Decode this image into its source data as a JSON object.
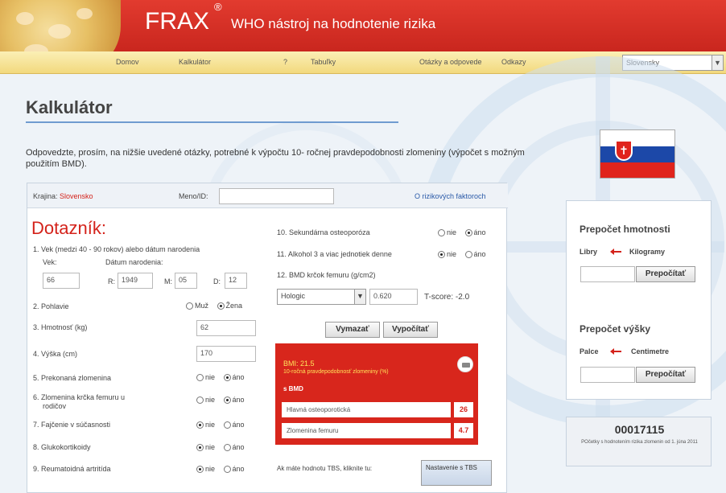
{
  "header": {
    "logo": "FRAX",
    "logo_mark": "®",
    "subtitle": "WHO nástroj na hodnotenie rizika"
  },
  "nav": {
    "items": [
      "Domov",
      "Kalkulátor",
      "?",
      "Tabuľky",
      "Otázky a odpovede",
      "Odkazy"
    ],
    "language": "Slovensky"
  },
  "page": {
    "title": "Kalkulátor",
    "intro": "Odpovedzte, prosím, na nižšie uvedené otázky, potrebné k výpočtu 10- ročnej pravdepodobnosti zlomeniny (výpočet s možným použitím BMD)."
  },
  "form": {
    "country_label": "Krajina:",
    "country_value": "Slovensko",
    "name_label": "Meno/ID:",
    "name_value": "",
    "risk_link": "O rizikových faktoroch",
    "heading": "Dotazník:",
    "q1": "1. Vek (medzi 40 - 90 rokov) alebo dátum narodenia",
    "age_label": "Vek:",
    "age_value": "66",
    "dob_label": "Dátum narodenia:",
    "dob_y_label": "R:",
    "dob_y": "1949",
    "dob_m_label": "M:",
    "dob_m": "05",
    "dob_d_label": "D:",
    "dob_d": "12",
    "q2": "2. Pohlavie",
    "sex_male": "Muž",
    "sex_female": "Žena",
    "q3": "3. Hmotnosť (kg)",
    "weight": "62",
    "q4": "4. Výška (cm)",
    "height": "170",
    "q5": "5. Prekonaná zlomenina",
    "q6a": "6. Zlomenina krčka femuru u",
    "q6b": "rodičov",
    "q7": "7. Fajčenie v súčasnosti",
    "q8": "8. Glukokortikoidy",
    "q9": "9. Reumatoidná artritída",
    "q10": "10. Sekundárna osteoporóza",
    "q11": "11. Alkohol 3 a viac jednotiek denne",
    "q12": "12. BMD krčok femuru (g/cm2)",
    "no": "nie",
    "yes": "áno",
    "bmd_device": "Hologic",
    "bmd_value": "0.620",
    "tscore": "T-score: -2.0",
    "btn_clear": "Vymazať",
    "btn_calc": "Vypočítať",
    "tbs_note": "Ak máte hodnotu TBS, kliknite tu:",
    "tbs_button": "Nastavenie s TBS"
  },
  "result": {
    "bmi": "BMI: 21.5",
    "prob_title": "10-ročná pravdepodobnosť zlomeniny (%)",
    "with_bmd": "s BMD",
    "major_label": "Hlavná osteoporotická",
    "major_value": "26",
    "hip_label": "Zlomenina femuru",
    "hip_value": "4.7"
  },
  "weight_conv": {
    "title": "Prepočet hmotnosti",
    "from": "Libry",
    "to": "Kilogramy",
    "button": "Prepočítať"
  },
  "height_conv": {
    "title": "Prepočet výšky",
    "from": "Palce",
    "to": "Centimetre",
    "button": "Prepočítať"
  },
  "counter": {
    "value": "00017115",
    "note": "POčetky s hodnotením rizika zlomenin od 1. júna 2011"
  }
}
